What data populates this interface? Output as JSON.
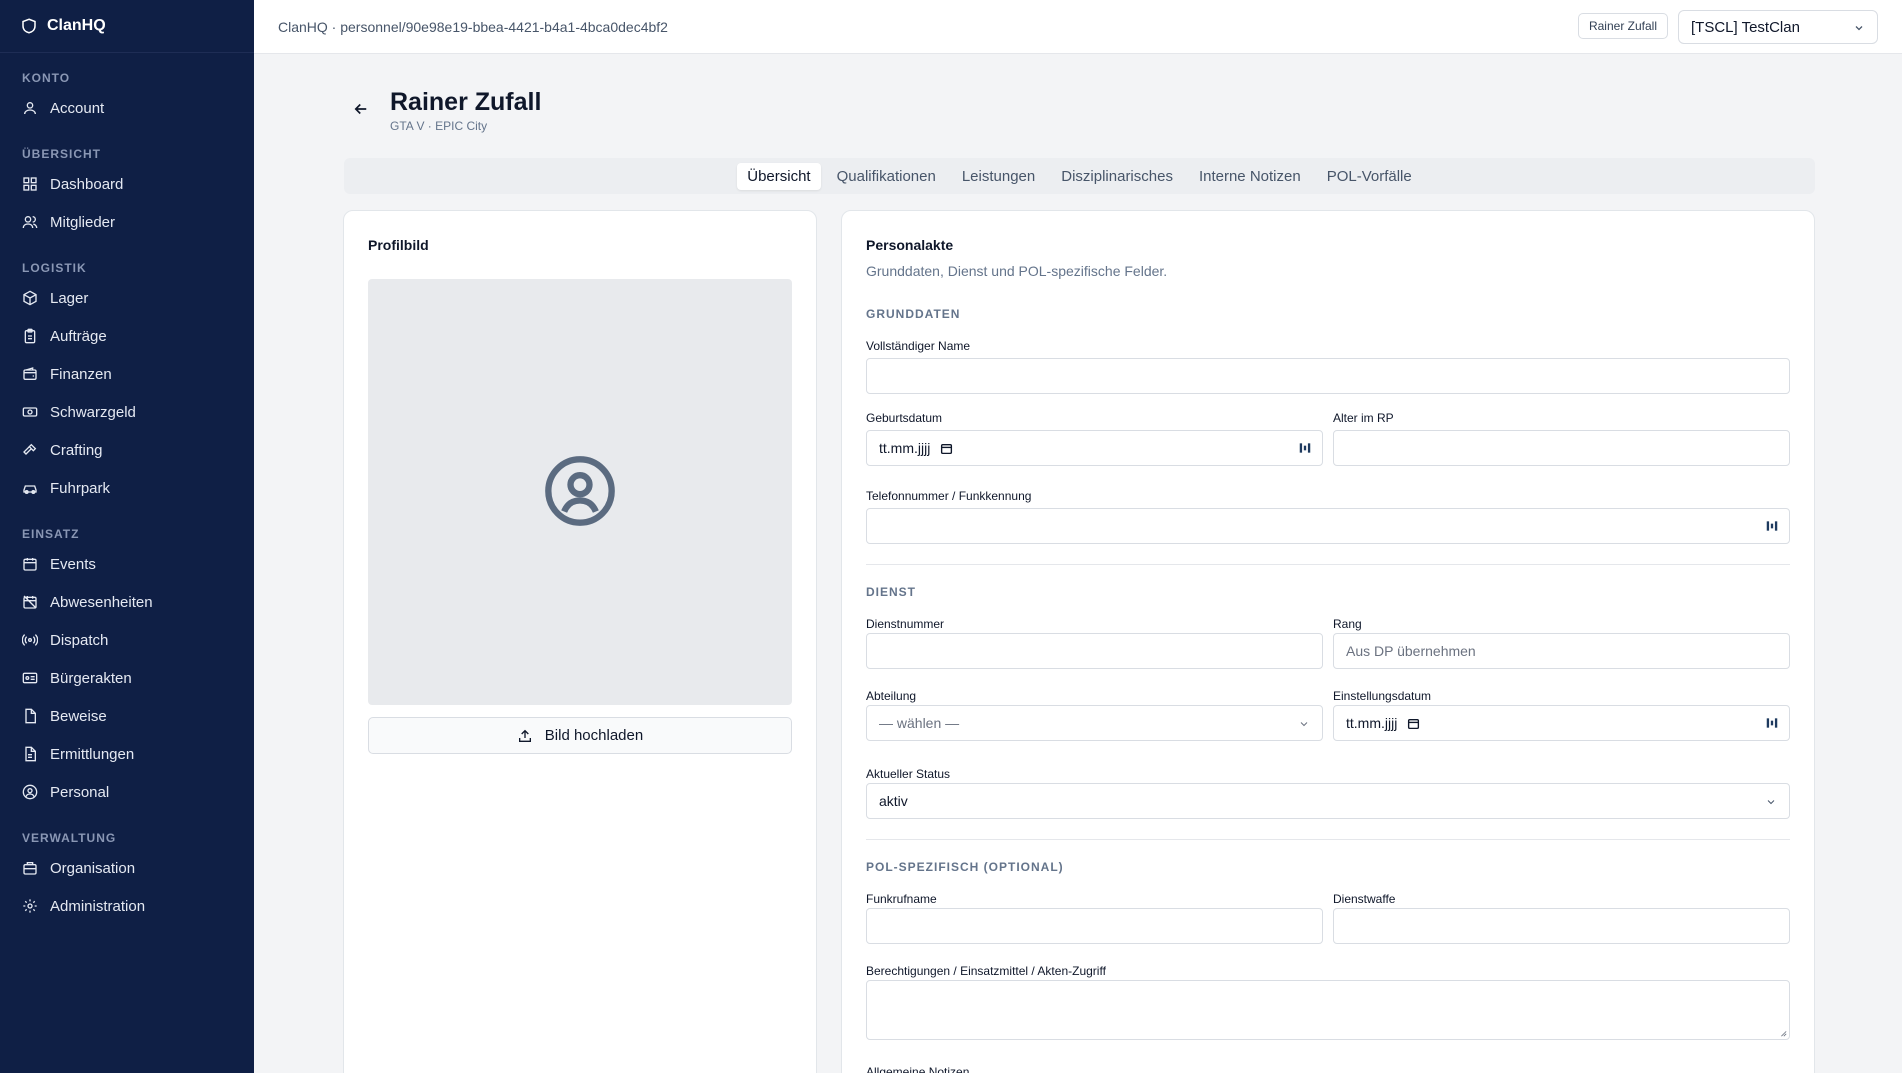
{
  "brand": {
    "name": "ClanHQ"
  },
  "sidebar": {
    "sections": [
      {
        "title": "KONTO",
        "items": [
          {
            "label": "Account",
            "icon": "user-icon"
          }
        ]
      },
      {
        "title": "ÜBERSICHT",
        "items": [
          {
            "label": "Dashboard",
            "icon": "grid-icon"
          },
          {
            "label": "Mitglieder",
            "icon": "users-icon"
          }
        ]
      },
      {
        "title": "LOGISTIK",
        "items": [
          {
            "label": "Lager",
            "icon": "package-icon"
          },
          {
            "label": "Aufträge",
            "icon": "clipboard-icon"
          },
          {
            "label": "Finanzen",
            "icon": "wallet-icon"
          },
          {
            "label": "Schwarzgeld",
            "icon": "banknote-icon"
          },
          {
            "label": "Crafting",
            "icon": "hammer-icon"
          },
          {
            "label": "Fuhrpark",
            "icon": "car-icon"
          }
        ]
      },
      {
        "title": "EINSATZ",
        "items": [
          {
            "label": "Events",
            "icon": "calendar-icon"
          },
          {
            "label": "Abwesenheiten",
            "icon": "calendar-off-icon"
          },
          {
            "label": "Dispatch",
            "icon": "radio-icon"
          },
          {
            "label": "Bürgerakten",
            "icon": "id-card-icon"
          },
          {
            "label": "Beweise",
            "icon": "file-icon"
          },
          {
            "label": "Ermittlungen",
            "icon": "file-text-icon"
          },
          {
            "label": "Personal",
            "icon": "user-circle-icon"
          }
        ]
      },
      {
        "title": "VERWALTUNG",
        "items": [
          {
            "label": "Organisation",
            "icon": "building-icon"
          },
          {
            "label": "Administration",
            "icon": "gear-icon"
          }
        ]
      }
    ]
  },
  "topbar": {
    "breadcrumb": "ClanHQ · personnel/90e98e19-bbea-4421-b4a1-4bca0dec4bf2",
    "user_chip": "Rainer Zufall",
    "clan_select": "[TSCL] TestClan"
  },
  "header": {
    "title": "Rainer Zufall",
    "subtitle": "GTA V · EPIC City"
  },
  "tabs": [
    "Übersicht",
    "Qualifikationen",
    "Leistungen",
    "Disziplinarisches",
    "Interne Notizen",
    "POL-Vorfälle"
  ],
  "profile": {
    "title": "Profilbild",
    "upload_label": "Bild hochladen"
  },
  "form": {
    "title": "Personalakte",
    "subtitle": "Grunddaten, Dienst und POL-spezifische Felder.",
    "sections": {
      "grunddaten": "GRUNDDATEN",
      "dienst": "DIENST",
      "pol": "POL-SPEZIFISCH (OPTIONAL)"
    },
    "labels": {
      "full_name": "Vollständiger Name",
      "birthdate": "Geburtsdatum",
      "age_rp": "Alter im RP",
      "phone": "Telefonnummer / Funkkennung",
      "service_number": "Dienstnummer",
      "rank": "Rang",
      "department": "Abteilung",
      "hire_date": "Einstellungsdatum",
      "status": "Aktueller Status",
      "callsign": "Funkrufname",
      "weapon": "Dienstwaffe",
      "permissions": "Berechtigungen / Einsatzmittel / Akten-Zugriff",
      "general_notes": "Allgemeine Notizen"
    },
    "values": {
      "birthdate": "tt.mm.jjjj",
      "rank_placeholder": "Aus DP übernehmen",
      "department": "— wählen —",
      "hire_date": "tt.mm.jjjj",
      "status": "aktiv"
    }
  }
}
